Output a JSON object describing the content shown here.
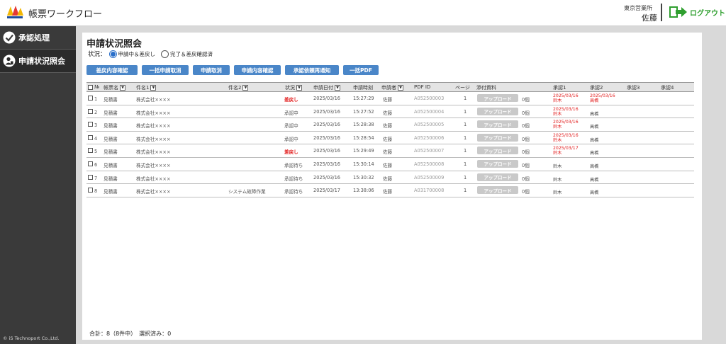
{
  "header": {
    "app_title": "帳票ワークフロー",
    "office": "東京営業所",
    "user": "佐藤",
    "logout_label": "ログアウト"
  },
  "sidebar": {
    "items": [
      {
        "label": "承認処理",
        "icon": "check-circle-icon"
      },
      {
        "label": "申請状況照会",
        "icon": "user-doc-icon"
      }
    ],
    "copyright": "© iS Technoport Co.,Ltd."
  },
  "page": {
    "title": "申請状況照会",
    "status_label": "状況：",
    "radio_options": [
      {
        "label": "申請中＆差戻し",
        "selected": true
      },
      {
        "label": "完了＆差戻確認済",
        "selected": false
      }
    ]
  },
  "toolbar": {
    "buttons": [
      "差戻内容確認",
      "一括申請取消",
      "申請取消",
      "申請内容確認",
      "承認依頼再通知",
      "一括PDF"
    ]
  },
  "table": {
    "headers": {
      "no": "№",
      "form_name": "帳票名",
      "subject1": "件名1",
      "subject2": "件名2",
      "status": "状況",
      "date": "申請日付",
      "time": "申請時刻",
      "applicant": "申請者",
      "pdf_id": "PDF ID",
      "page": "ページ",
      "attachments": "添付資料",
      "approval1": "承認1",
      "approval2": "承認2",
      "approval3": "承認3",
      "approval4": "承認4"
    },
    "upload_label": "アップロード",
    "rows": [
      {
        "no": "1",
        "form_name": "見積書",
        "subject1": "株式会社××××",
        "subject2": "",
        "status": "差戻し",
        "status_red": true,
        "date": "2025/03/16",
        "time": "15:27:29",
        "applicant": "佐藤",
        "pdf_id": "A052500003",
        "page": "1",
        "count": "0個",
        "a1_date": "2025/03/16",
        "a1_name": "鈴木",
        "a1_red": true,
        "a2_date": "2025/03/16",
        "a2_name": "高橋",
        "a2_red": true
      },
      {
        "no": "2",
        "form_name": "見積書",
        "subject1": "株式会社××××",
        "subject2": "",
        "status": "承認中",
        "status_red": false,
        "date": "2025/03/16",
        "time": "15:27:52",
        "applicant": "佐藤",
        "pdf_id": "A052500004",
        "page": "1",
        "count": "0個",
        "a1_date": "2025/03/16",
        "a1_name": "鈴木",
        "a1_red": true,
        "a2_date": "",
        "a2_name": "高橋",
        "a2_red": false
      },
      {
        "no": "3",
        "form_name": "見積書",
        "subject1": "株式会社××××",
        "subject2": "",
        "status": "承認中",
        "status_red": false,
        "date": "2025/03/16",
        "time": "15:28:38",
        "applicant": "佐藤",
        "pdf_id": "A052500005",
        "page": "1",
        "count": "0個",
        "a1_date": "2025/03/16",
        "a1_name": "鈴木",
        "a1_red": true,
        "a2_date": "",
        "a2_name": "高橋",
        "a2_red": false
      },
      {
        "no": "4",
        "form_name": "見積書",
        "subject1": "株式会社××××",
        "subject2": "",
        "status": "承認中",
        "status_red": false,
        "date": "2025/03/16",
        "time": "15:28:54",
        "applicant": "佐藤",
        "pdf_id": "A052500006",
        "page": "1",
        "count": "0個",
        "a1_date": "2025/03/16",
        "a1_name": "鈴木",
        "a1_red": true,
        "a2_date": "",
        "a2_name": "高橋",
        "a2_red": false
      },
      {
        "no": "5",
        "form_name": "見積書",
        "subject1": "株式会社××××",
        "subject2": "",
        "status": "差戻し",
        "status_red": true,
        "date": "2025/03/16",
        "time": "15:29:49",
        "applicant": "佐藤",
        "pdf_id": "A052500007",
        "page": "1",
        "count": "0個",
        "a1_date": "2025/03/17",
        "a1_name": "鈴木",
        "a1_red": true,
        "a2_date": "",
        "a2_name": "高橋",
        "a2_red": false
      },
      {
        "no": "6",
        "form_name": "見積書",
        "subject1": "株式会社××××",
        "subject2": "",
        "status": "承認待ち",
        "status_red": false,
        "date": "2025/03/16",
        "time": "15:30:14",
        "applicant": "佐藤",
        "pdf_id": "A052500008",
        "page": "1",
        "count": "0個",
        "a1_date": "",
        "a1_name": "鈴木",
        "a1_red": false,
        "a2_date": "",
        "a2_name": "高橋",
        "a2_red": false
      },
      {
        "no": "7",
        "form_name": "見積書",
        "subject1": "株式会社××××",
        "subject2": "",
        "status": "承認待ち",
        "status_red": false,
        "date": "2025/03/16",
        "time": "15:30:32",
        "applicant": "佐藤",
        "pdf_id": "A052500009",
        "page": "1",
        "count": "0個",
        "a1_date": "",
        "a1_name": "鈴木",
        "a1_red": false,
        "a2_date": "",
        "a2_name": "高橋",
        "a2_red": false
      },
      {
        "no": "8",
        "form_name": "見積書",
        "subject1": "株式会社××××",
        "subject2": "システム故障作業",
        "status": "承認待ち",
        "status_red": false,
        "date": "2025/03/17",
        "time": "13:38:06",
        "applicant": "佐藤",
        "pdf_id": "A031700008",
        "page": "1",
        "count": "0個",
        "a1_date": "",
        "a1_name": "鈴木",
        "a1_red": false,
        "a2_date": "",
        "a2_name": "高橋",
        "a2_red": false
      }
    ]
  },
  "summary": "合計：8（8件中）　選択済み：0",
  "colors": {
    "accent_blue": "#4a86c8",
    "status_red": "#e21b1b",
    "logout_green": "#2f9f2f",
    "sidebar_bg": "#3a3a3a"
  }
}
